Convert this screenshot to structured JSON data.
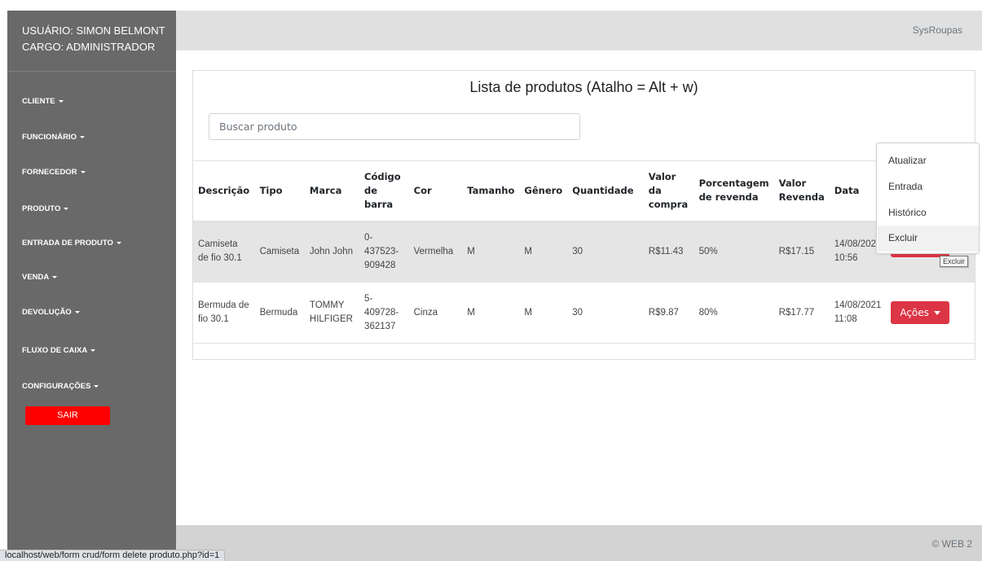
{
  "sidebar": {
    "user_line": "USUÁRIO: SIMON BELMONT",
    "role_line": "CARGO: ADMINISTRADOR",
    "items": [
      {
        "label": "CLIENTE"
      },
      {
        "label": "FUNCIONÁRIO"
      },
      {
        "label": "FORNECEDOR"
      },
      {
        "label": "PRODUTO"
      },
      {
        "label": "ENTRADA DE PRODUTO"
      },
      {
        "label": "VENDA"
      },
      {
        "label": "DEVOLUÇÃO"
      },
      {
        "label": "FLUXO DE CAIXA"
      },
      {
        "label": "CONFIGURAÇÕES"
      }
    ],
    "logout_label": "SAIR"
  },
  "header": {
    "brand": "SysRoupas"
  },
  "main": {
    "title": "Lista de produtos (Atalho = Alt + w)",
    "search_placeholder": "Buscar produto",
    "columns": [
      "Descrição",
      "Tipo",
      "Marca",
      "Código de barra",
      "Cor",
      "Tamanho",
      "Gênero",
      "Quantidade",
      "Valor da compra",
      "Porcentagem de revenda",
      "Valor Revenda",
      "Data",
      ""
    ],
    "rows": [
      {
        "descricao": "Camiseta de fio 30.1",
        "tipo": "Camiseta",
        "marca": "John John",
        "codigo": "0-437523-909428",
        "cor": "Vermelha",
        "tamanho": "M",
        "genero": "M",
        "quantidade": "30",
        "valor_compra": "R$11.43",
        "porcentagem": "50%",
        "valor_revenda": "R$17.15",
        "data": "14/08/2021 10:56",
        "acao": ""
      },
      {
        "descricao": "Bermuda de fio 30.1",
        "tipo": "Bermuda",
        "marca": "TOMMY HILFIGER",
        "codigo": "5-409728-362137",
        "cor": "Cinza",
        "tamanho": "M",
        "genero": "M",
        "quantidade": "30",
        "valor_compra": "R$9.87",
        "porcentagem": "80%",
        "valor_revenda": "R$17.77",
        "data": "14/08/2021 11:08",
        "acao": "Ações"
      }
    ]
  },
  "dropdown": {
    "items": [
      "Atualizar",
      "Entrada",
      "Histórico",
      "Excluir"
    ],
    "tooltip": "Excluir"
  },
  "footer": {
    "copyright": "© WEB 2"
  },
  "browser": {
    "status_url": "localhost/web/form crud/form delete produto.php?id=1"
  },
  "colors": {
    "sidebar": "#696969",
    "danger": "#dc3545",
    "logout": "#ff0000"
  }
}
